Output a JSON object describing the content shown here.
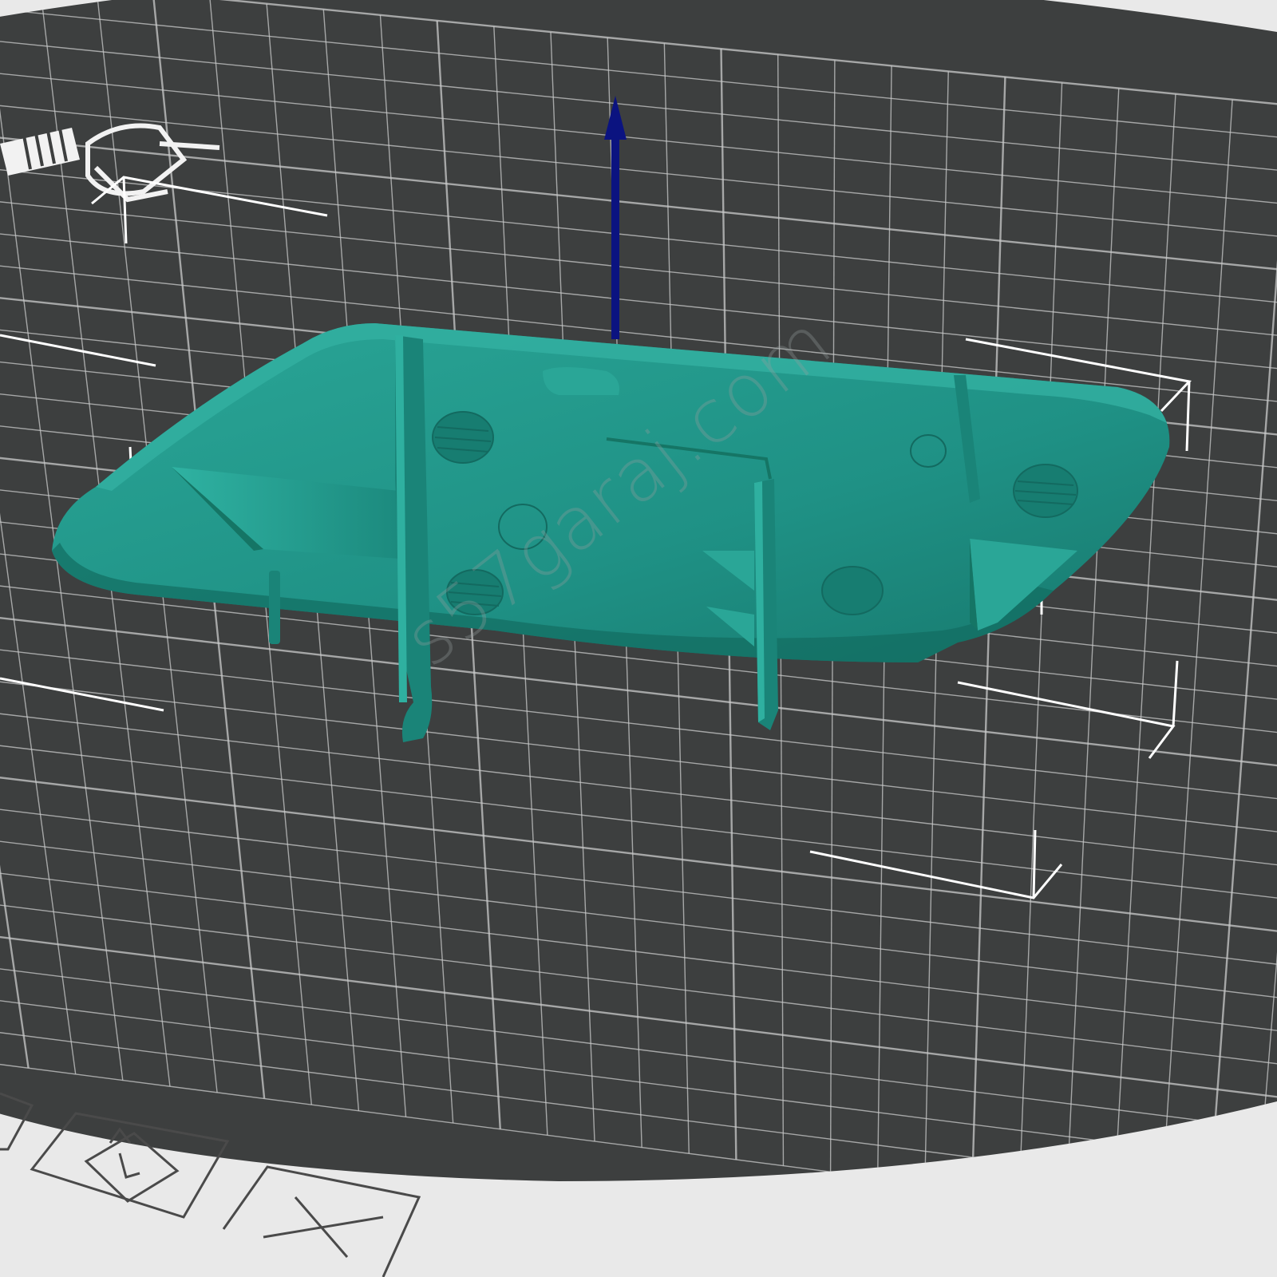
{
  "app": {
    "view": "3d-build-plate-viewport"
  },
  "watermark": {
    "text": "s57garaj.com"
  },
  "colors": {
    "plate": "#3d3f3f",
    "plate_edge": "#2f3131",
    "grid": "#c9cbcb",
    "model": "#1f9185",
    "model_shadow": "#14705f",
    "model_highlight": "#33b0a1",
    "z_axis": "#0b1380",
    "bbox": "#ffffff",
    "background": "#e9e9e9"
  },
  "icons": [
    {
      "name": "printer-logo-icon"
    },
    {
      "name": "rotate-view-icon"
    },
    {
      "name": "close-icon"
    },
    {
      "name": "z-axis-arrow-icon"
    }
  ]
}
